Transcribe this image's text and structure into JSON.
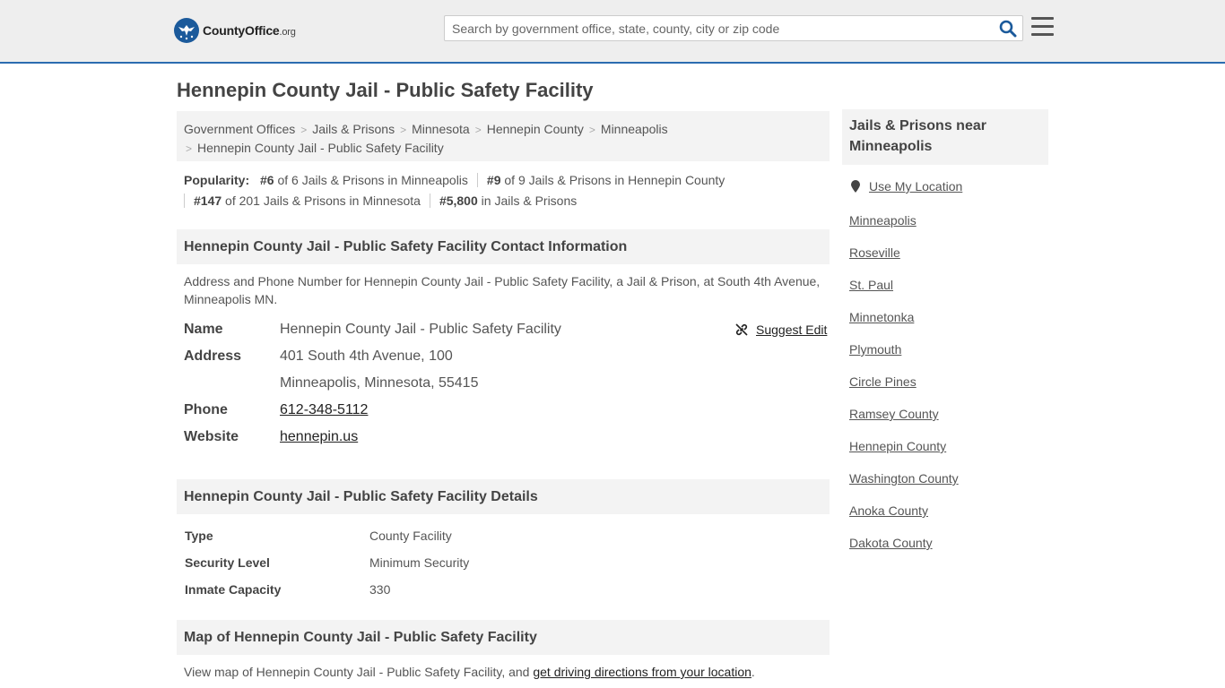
{
  "header": {
    "logo_main": "CountyOffice",
    "logo_tld": ".org",
    "search_placeholder": "Search by government office, state, county, city or zip code"
  },
  "page": {
    "title": "Hennepin County Jail - Public Safety Facility"
  },
  "breadcrumb": [
    "Government Offices",
    "Jails & Prisons",
    "Minnesota",
    "Hennepin County",
    "Minneapolis",
    "Hennepin County Jail - Public Safety Facility"
  ],
  "popularity": {
    "label": "Popularity:",
    "items": [
      {
        "rank": "#6",
        "text": "of 6 Jails & Prisons in Minneapolis"
      },
      {
        "rank": "#9",
        "text": "of 9 Jails & Prisons in Hennepin County"
      },
      {
        "rank": "#147",
        "text": "of 201 Jails & Prisons in Minnesota"
      },
      {
        "rank": "#5,800",
        "text": "in Jails & Prisons"
      }
    ]
  },
  "contact": {
    "heading": "Hennepin County Jail - Public Safety Facility Contact Information",
    "description": "Address and Phone Number for Hennepin County Jail - Public Safety Facility, a Jail & Prison, at South 4th Avenue, Minneapolis MN.",
    "suggest_edit": "Suggest Edit",
    "name_label": "Name",
    "name_value": "Hennepin County Jail - Public Safety Facility",
    "address_label": "Address",
    "address_line1": "401 South 4th Avenue, 100",
    "address_line2": "Minneapolis, Minnesota, 55415",
    "phone_label": "Phone",
    "phone_value": "612-348-5112",
    "website_label": "Website",
    "website_value": "hennepin.us"
  },
  "details": {
    "heading": "Hennepin County Jail - Public Safety Facility Details",
    "rows": [
      {
        "label": "Type",
        "value": "County Facility"
      },
      {
        "label": "Security Level",
        "value": "Minimum Security"
      },
      {
        "label": "Inmate Capacity",
        "value": "330"
      }
    ]
  },
  "map": {
    "heading": "Map of Hennepin County Jail - Public Safety Facility",
    "desc_prefix": "View map of Hennepin County Jail - Public Safety Facility, and ",
    "desc_link": "get driving directions from your location",
    "desc_suffix": "."
  },
  "sidebar": {
    "heading": "Jails & Prisons near Minneapolis",
    "use_location": "Use My Location",
    "links": [
      "Minneapolis",
      "Roseville",
      "St. Paul",
      "Minnetonka",
      "Plymouth",
      "Circle Pines",
      "Ramsey County",
      "Hennepin County",
      "Washington County",
      "Anoka County",
      "Dakota County"
    ]
  },
  "colors": {
    "header_bg": "#eeeeee",
    "header_border": "#2b6cb0",
    "logo_blue": "#1b5a9b",
    "search_icon": "#1b5a9b",
    "section_bg": "#f3f3f3"
  },
  "icons": {
    "logo": "eagle-seal-icon",
    "search": "search-icon",
    "menu": "hamburger-menu-icon",
    "suggest": "broken-link-icon",
    "location": "map-pin-icon"
  }
}
